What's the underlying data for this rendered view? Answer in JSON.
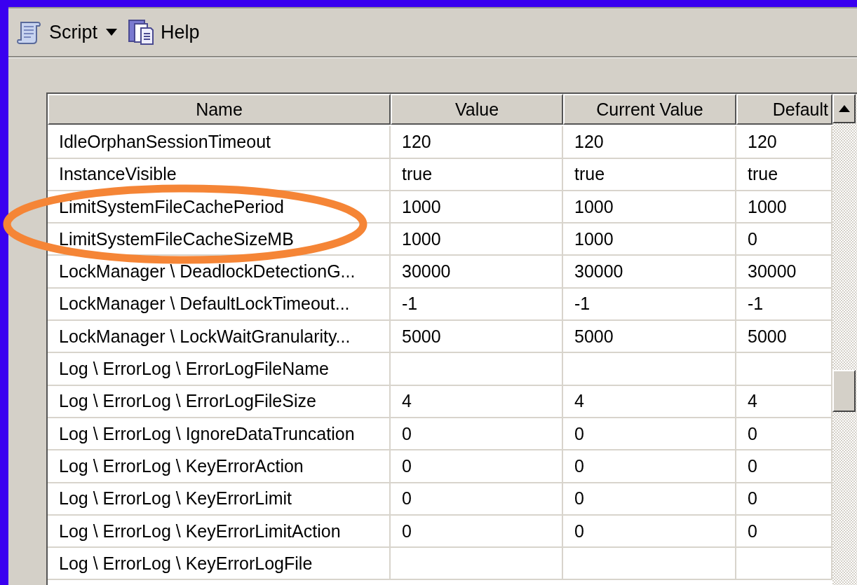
{
  "toolbar": {
    "items": [
      {
        "kind": "script",
        "label": "Script"
      },
      {
        "kind": "help",
        "label": "Help"
      }
    ]
  },
  "table": {
    "columns": [
      "Name",
      "Value",
      "Current Value",
      "Default"
    ],
    "rows": [
      {
        "name": "IdleOrphanSessionTimeout",
        "value": "120",
        "current_value": "120",
        "default": "120"
      },
      {
        "name": "InstanceVisible",
        "value": "true",
        "current_value": "true",
        "default": "true"
      },
      {
        "name": "LimitSystemFileCachePeriod",
        "value": "1000",
        "current_value": "1000",
        "default": "1000"
      },
      {
        "name": "LimitSystemFileCacheSizeMB",
        "value": "1000",
        "current_value": "1000",
        "default": "0"
      },
      {
        "name": "LockManager \\ DeadlockDetectionG...",
        "value": "30000",
        "current_value": "30000",
        "default": "30000"
      },
      {
        "name": "LockManager \\ DefaultLockTimeout...",
        "value": "-1",
        "current_value": "-1",
        "default": "-1"
      },
      {
        "name": "LockManager \\ LockWaitGranularity...",
        "value": "5000",
        "current_value": "5000",
        "default": "5000"
      },
      {
        "name": "Log \\ ErrorLog \\ ErrorLogFileName"
      },
      {
        "name": "Log \\ ErrorLog \\ ErrorLogFileSize",
        "value": "4",
        "current_value": "4",
        "default": "4"
      },
      {
        "name": "Log \\ ErrorLog \\ IgnoreDataTruncation",
        "value": "0",
        "current_value": "0",
        "default": "0"
      },
      {
        "name": "Log \\ ErrorLog \\ KeyErrorAction",
        "value": "0",
        "current_value": "0",
        "default": "0"
      },
      {
        "name": "Log \\ ErrorLog \\ KeyErrorLimit",
        "value": "0",
        "current_value": "0",
        "default": "0"
      },
      {
        "name": "Log \\ ErrorLog \\ KeyErrorLimitAction",
        "value": "0",
        "current_value": "0",
        "default": "0"
      },
      {
        "name": "Log \\ ErrorLog \\ KeyErrorLogFile"
      }
    ]
  }
}
